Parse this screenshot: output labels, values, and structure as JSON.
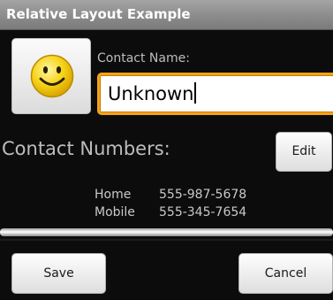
{
  "window": {
    "title": "Relative Layout Example"
  },
  "contact": {
    "avatar_icon": "smiley-face-icon",
    "name_label": "Contact Name:",
    "name_value": "Unknown"
  },
  "numbers": {
    "heading": "Contact Numbers:",
    "edit_label": "Edit",
    "entries": [
      {
        "label": "Home",
        "value": "555-987-5678"
      },
      {
        "label": "Mobile",
        "value": "555-345-7654"
      }
    ]
  },
  "actions": {
    "save_label": "Save",
    "cancel_label": "Cancel"
  },
  "colors": {
    "background": "#0c0c0c",
    "focus_border": "#f6a21a",
    "smiley_fill": "#f7d51b"
  }
}
